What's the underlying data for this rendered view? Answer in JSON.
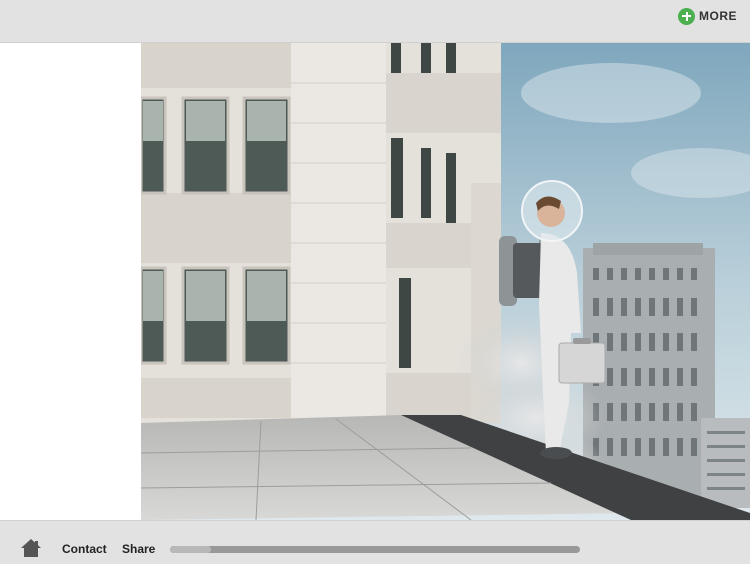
{
  "header": {
    "more_label": "MORE",
    "more_icon": "plus-circle-icon",
    "accent_color": "#4caf50"
  },
  "hero": {
    "alt": "Astronaut with jetpack standing on a city rooftop"
  },
  "footer": {
    "home_icon": "home-icon",
    "contact_label": "Contact",
    "share_label": "Share",
    "progress": 0.1
  }
}
